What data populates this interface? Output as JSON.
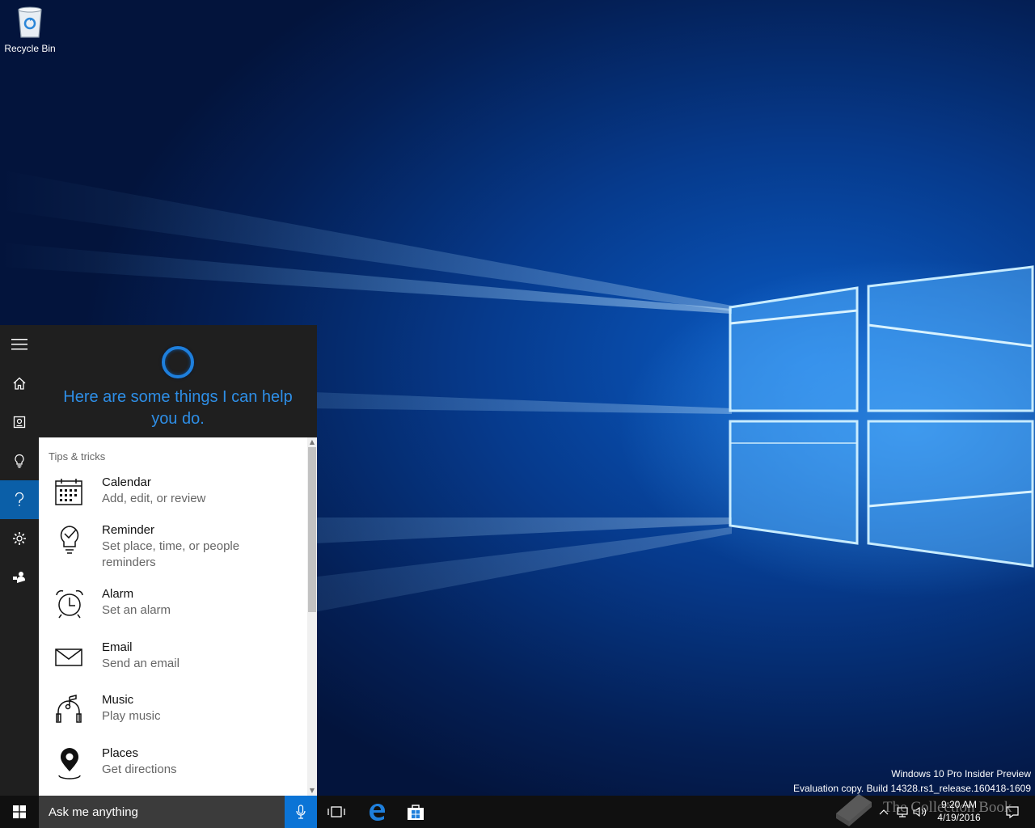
{
  "desktop": {
    "recycle_bin_label": "Recycle Bin",
    "watermark_line1": "Windows 10 Pro Insider Preview",
    "watermark_line2": "Evaluation copy. Build 14328.rs1_release.160418-1609",
    "overlay_text": "The Collection Book"
  },
  "cortana": {
    "rail": [
      {
        "name": "hamburger-menu-icon",
        "active": false
      },
      {
        "name": "home-icon",
        "active": false
      },
      {
        "name": "notebook-icon",
        "active": false
      },
      {
        "name": "lightbulb-icon",
        "active": false
      },
      {
        "name": "help-icon",
        "active": true
      },
      {
        "name": "gear-icon",
        "active": false
      },
      {
        "name": "feedback-icon",
        "active": false
      }
    ],
    "greeting": "Here are some things I can help you do.",
    "tips_title": "Tips & tricks",
    "tips": [
      {
        "icon": "calendar-icon",
        "title": "Calendar",
        "subtitle": "Add, edit, or review"
      },
      {
        "icon": "reminder-icon",
        "title": "Reminder",
        "subtitle": "Set place, time, or people reminders"
      },
      {
        "icon": "alarm-icon",
        "title": "Alarm",
        "subtitle": "Set an alarm"
      },
      {
        "icon": "email-icon",
        "title": "Email",
        "subtitle": "Send an email"
      },
      {
        "icon": "music-icon",
        "title": "Music",
        "subtitle": "Play music"
      },
      {
        "icon": "places-icon",
        "title": "Places",
        "subtitle": "Get directions"
      }
    ]
  },
  "taskbar": {
    "search_placeholder": "Ask me anything",
    "clock_time": "9:20 AM",
    "clock_date": "4/19/2016",
    "colors": {
      "accent": "#0b74d6",
      "background": "#101010"
    }
  }
}
